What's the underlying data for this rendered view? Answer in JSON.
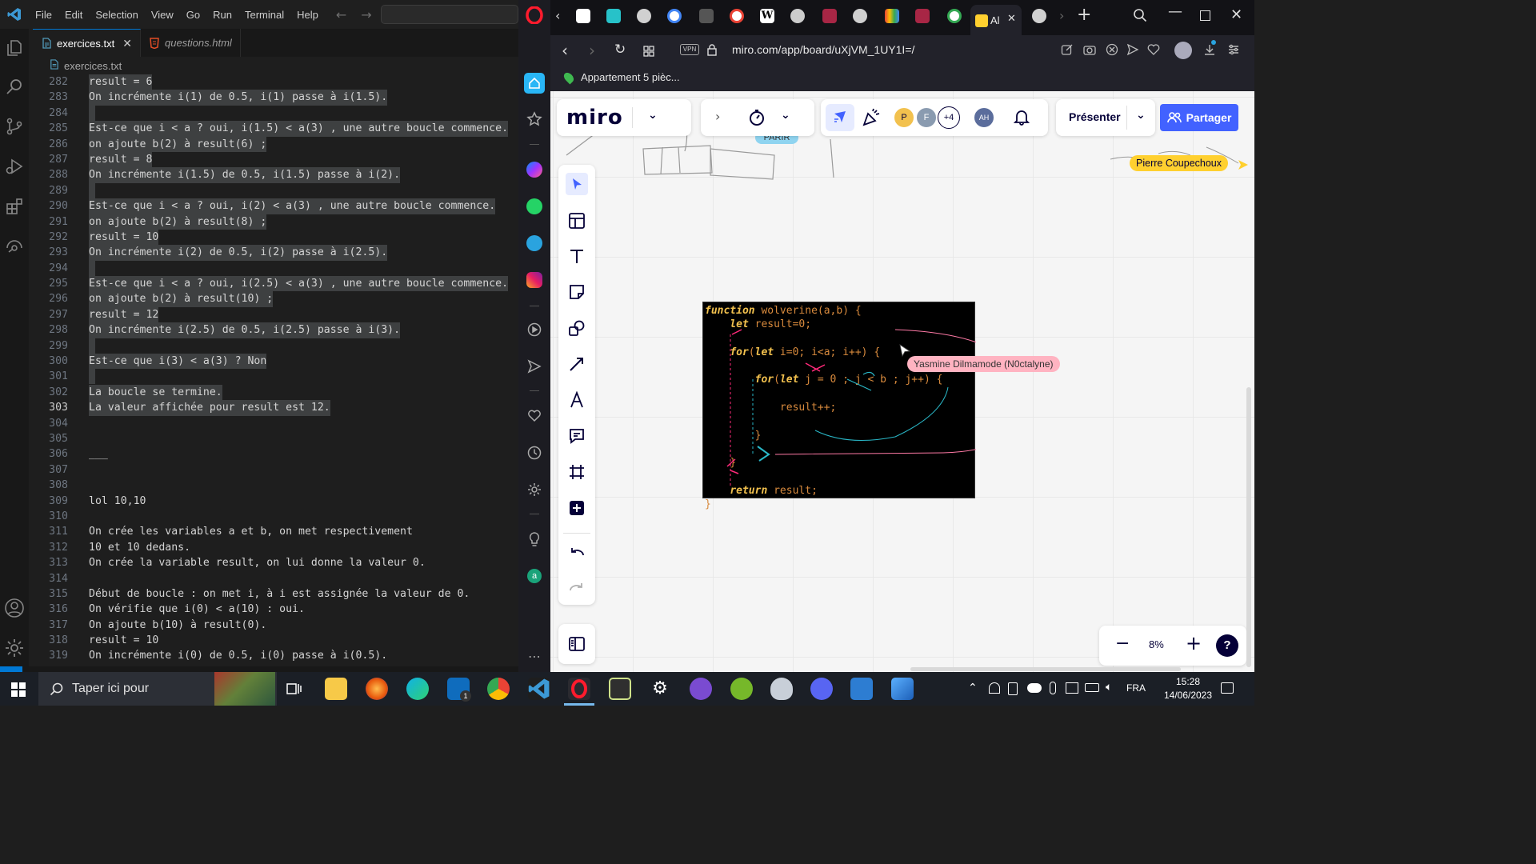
{
  "vscode": {
    "menu": [
      "File",
      "Edit",
      "Selection",
      "View",
      "Go",
      "Run",
      "Terminal",
      "Help"
    ],
    "tabs": [
      {
        "label": "exercices.txt",
        "active": true,
        "close": "✕"
      },
      {
        "label": "questions.html",
        "active": false
      }
    ],
    "breadcrumb": "exercices.txt",
    "current_line": 303,
    "lines": [
      {
        "n": "282",
        "text": "result = 6",
        "sel": true
      },
      {
        "n": "283",
        "text": "On incrémente i(1) de 0.5, i(1) passe à i(1.5).",
        "sel": true
      },
      {
        "n": "284",
        "text": "",
        "sel": true
      },
      {
        "n": "285",
        "text": "Est-ce que i < a ? oui, i(1.5) < a(3) , une autre boucle commence.",
        "sel": true
      },
      {
        "n": "286",
        "text": "on ajoute b(2) à result(6) ;",
        "sel": true
      },
      {
        "n": "287",
        "text": "result = 8",
        "sel": true
      },
      {
        "n": "288",
        "text": "On incrémente i(1.5) de 0.5, i(1.5) passe à i(2).",
        "sel": true
      },
      {
        "n": "289",
        "text": "",
        "sel": true
      },
      {
        "n": "290",
        "text": "Est-ce que i < a ? oui, i(2) < a(3) , une autre boucle commence.",
        "sel": true
      },
      {
        "n": "291",
        "text": "on ajoute b(2) à result(8) ;",
        "sel": true
      },
      {
        "n": "292",
        "text": "result = 10",
        "sel": true
      },
      {
        "n": "293",
        "text": "On incrémente i(2) de 0.5, i(2) passe à i(2.5).",
        "sel": true
      },
      {
        "n": "294",
        "text": "",
        "sel": true
      },
      {
        "n": "295",
        "text": "Est-ce que i < a ? oui, i(2.5) < a(3) , une autre boucle commence.",
        "sel": true
      },
      {
        "n": "296",
        "text": "on ajoute b(2) à result(10) ;",
        "sel": true
      },
      {
        "n": "297",
        "text": "result = 12",
        "sel": true
      },
      {
        "n": "298",
        "text": "On incrémente i(2.5) de 0.5, i(2.5) passe à i(3).",
        "sel": true
      },
      {
        "n": "299",
        "text": "",
        "sel": true
      },
      {
        "n": "300",
        "text": "Est-ce que i(3) < a(3) ? Non",
        "sel": true
      },
      {
        "n": "301",
        "text": "",
        "sel": true
      },
      {
        "n": "302",
        "text": "La boucle se termine.",
        "sel": true
      },
      {
        "n": "303",
        "text": "La valeur affichée pour result est 12.",
        "sel": true
      },
      {
        "n": "304",
        "text": "",
        "sel": false
      },
      {
        "n": "305",
        "text": "",
        "sel": false
      },
      {
        "n": "306",
        "text": "___",
        "sel": false
      },
      {
        "n": "307",
        "text": "",
        "sel": false
      },
      {
        "n": "308",
        "text": "",
        "sel": false
      },
      {
        "n": "309",
        "text": "lol 10,10",
        "sel": false
      },
      {
        "n": "310",
        "text": "",
        "sel": false
      },
      {
        "n": "311",
        "text": "On crée les variables a et b, on met respectivement",
        "sel": false
      },
      {
        "n": "312",
        "text": "10 et 10 dedans.",
        "sel": false
      },
      {
        "n": "313",
        "text": "On crée la variable result, on lui donne la valeur 0.",
        "sel": false
      },
      {
        "n": "314",
        "text": "",
        "sel": false
      },
      {
        "n": "315",
        "text": "Début de boucle : on met i, à i est assignée la valeur de 0.",
        "sel": false
      },
      {
        "n": "316",
        "text": "On vérifie que i(0) < a(10) : oui.",
        "sel": false
      },
      {
        "n": "317",
        "text": "On ajoute b(10) à result(0).",
        "sel": false
      },
      {
        "n": "318",
        "text": "result = 10",
        "sel": false
      },
      {
        "n": "319",
        "text": "On incrémente i(0) de 0.5, i(0) passe à i(0.5).",
        "sel": false
      }
    ]
  },
  "browser": {
    "active_tab_label": "Al",
    "url": "miro.com/app/board/uXjVM_1UY1I=/",
    "vpn_label": "VPN",
    "bookmark": "Appartement 5 pièc..."
  },
  "miro": {
    "logo": "miro",
    "present_label": "Présenter",
    "share_label": "Partager",
    "avatars": [
      {
        "letter": "P",
        "color": "#f2c14e"
      },
      {
        "letter": "F",
        "color": "#8a9bb0"
      },
      {
        "letter": "+4",
        "color": "#ffffff"
      }
    ],
    "own_avatar": "AH",
    "zoom": "8%",
    "help": "?",
    "cursor_pierre": "Pierre Coupechoux",
    "cursor_yasmine": "Yasmine Dilmamode (N0ctalyne)",
    "code_lines": [
      "function wolverine(a,b) {",
      "    let result=0;",
      "",
      "    for(let i=0; i<a; i++) {",
      "",
      "        for(let j = 0 ; j < b ; j++) {",
      "",
      "            result++;",
      "",
      "        }",
      "",
      "    }",
      "",
      "    return result;",
      "}"
    ],
    "sketch_label": "PARIR"
  },
  "taskbar": {
    "search_placeholder": "Taper ici pour",
    "lang": "FRA",
    "time": "15:28",
    "date": "14/06/2023",
    "mail_badge": "1"
  },
  "colors": {
    "vscode_bg": "#1e1e1e",
    "selection": "#5a5d5e",
    "miro_share": "#4262ff",
    "opera_red": "#ff1b2d"
  }
}
